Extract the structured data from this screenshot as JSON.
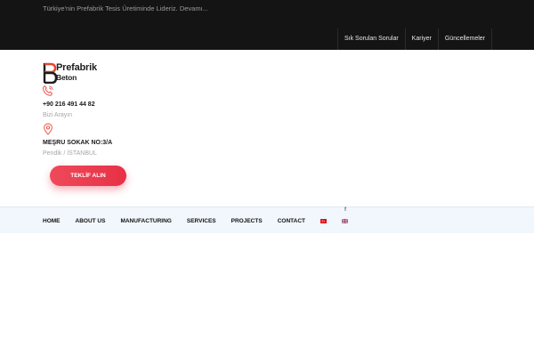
{
  "topbar": {
    "announcement": "Türkiye'nin Prefabrik Tesis Üretiminde Lideriz. Devamı...",
    "links": [
      "Sık Sorulan Sorular",
      "Kariyer",
      "Güncellemeler"
    ]
  },
  "logo": {
    "line1": "Prefabrik",
    "line2": "Beton",
    "accent": "#e8452c"
  },
  "contact": {
    "phone": "+90 216 491 44 82",
    "phone_label": "Bizi Arayın",
    "address": "MEŞRU SOKAK NO:3/A",
    "address_sub": "Pendik / İSTANBUL",
    "icon_color": "#e8453c"
  },
  "cta": {
    "label": "TEKLİF ALIN"
  },
  "nav": {
    "items": [
      "HOME",
      "ABOUT US",
      "MANUFACTURING",
      "SERVICES",
      "PROJECTS",
      "CONTACT"
    ],
    "social": "f"
  },
  "icons": {
    "phone": "phone-icon",
    "location": "location-pin-icon",
    "facebook": "facebook-icon",
    "flag_tr": "turkish-flag-icon",
    "flag_en": "uk-flag-icon"
  }
}
